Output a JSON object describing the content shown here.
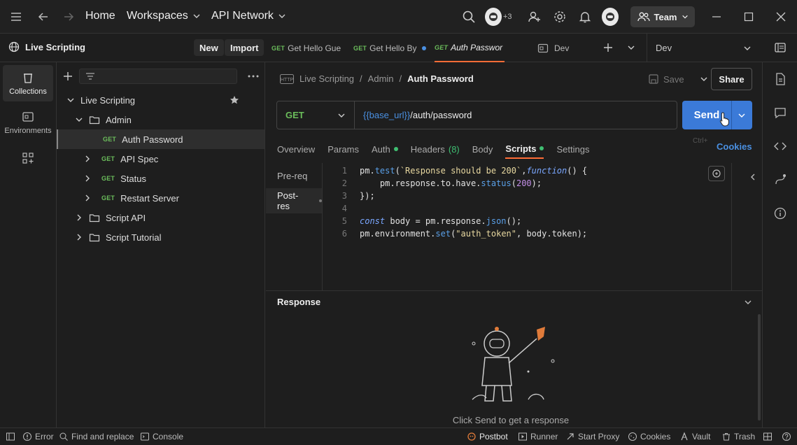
{
  "topbar": {
    "home": "Home",
    "workspaces": "Workspaces",
    "api_network": "API Network",
    "invite_count": "+3",
    "team": "Team"
  },
  "workspace": {
    "name": "Live Scripting",
    "new_label": "New",
    "import_label": "Import"
  },
  "tabs": [
    {
      "method": "GET",
      "label": "Get Hello Gue"
    },
    {
      "method": "GET",
      "label": "Get Hello By"
    },
    {
      "method": "GET",
      "label": "Auth Passwor"
    },
    {
      "label": "Dev"
    }
  ],
  "environment": {
    "selected": "Dev"
  },
  "rail": [
    {
      "label": "Collections"
    },
    {
      "label": "Environments"
    }
  ],
  "tree": [
    {
      "label": "Live Scripting"
    },
    {
      "label": "Admin"
    },
    {
      "method": "GET",
      "label": "Auth Password"
    },
    {
      "method": "GET",
      "label": "API Spec"
    },
    {
      "method": "GET",
      "label": "Status"
    },
    {
      "method": "GET",
      "label": "Restart Server"
    },
    {
      "label": "Script API"
    },
    {
      "label": "Script Tutorial"
    }
  ],
  "request": {
    "breadcrumb": [
      "Live Scripting",
      "Admin",
      "Auth Password"
    ],
    "save_label": "Save",
    "share_label": "Share",
    "method": "GET",
    "url_var": "{{base_url}}",
    "url_path": "/auth/password",
    "send_label": "Send",
    "tabs": [
      "Overview",
      "Params",
      "Auth",
      "Headers",
      "(8)",
      "Body",
      "Scripts",
      "Settings"
    ],
    "cookies_label": "Cookies",
    "hint_ghost": "Ctrl+"
  },
  "scripts": {
    "nav": [
      "Pre-req",
      "Post-res"
    ],
    "line_numbers": [
      "1",
      "2",
      "3",
      "4",
      "5",
      "6"
    ],
    "code": {
      "l1_a": "pm.",
      "l1_b": "test",
      "l1_c": "(",
      "l1_d": "`Response should be 200`",
      "l1_e": ", ",
      "l1_f": "function",
      "l1_g": " () {",
      "l2_a": "    pm.response.to.have.",
      "l2_b": "status",
      "l2_c": "(",
      "l2_d": "200",
      "l2_e": ");",
      "l3": "});",
      "l5_a": "const",
      "l5_b": " body = pm.response.",
      "l5_c": "json",
      "l5_d": "();",
      "l6_a": "pm.environment.",
      "l6_b": "set",
      "l6_c": "(",
      "l6_d": "\"auth_token\"",
      "l6_e": ", body.token);"
    }
  },
  "response": {
    "title": "Response",
    "hint": "Click Send to get a response"
  },
  "status": {
    "error": "Error",
    "find_replace": "Find and replace",
    "console": "Console",
    "postbot": "Postbot",
    "runner": "Runner",
    "start_proxy": "Start Proxy",
    "cookies": "Cookies",
    "vault": "Vault",
    "trash": "Trash"
  },
  "colors": {
    "accent": "#ff6c37",
    "send": "#3b7ad8",
    "get": "#6bbd5b",
    "link": "#4a90e2"
  }
}
